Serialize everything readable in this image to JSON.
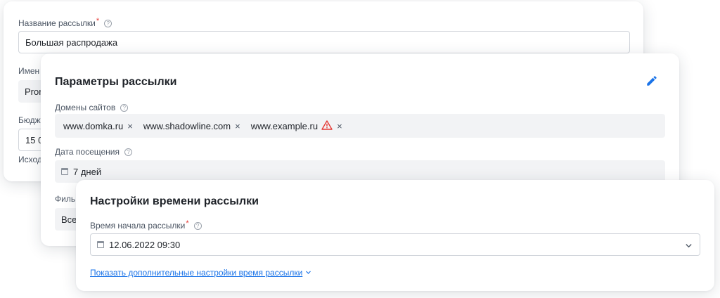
{
  "campaign_card": {
    "name_label": "Название рассылки",
    "name_required": "*",
    "name_value": "Большая распродажа",
    "sender_label_partial": "Имен",
    "sender_value_partial": "Pron",
    "budget_label_partial": "Бюдж",
    "budget_value_partial": "15 0",
    "source_label_partial": "Исход"
  },
  "params_card": {
    "title": "Параметры рассылки",
    "domains_label": "Домены сайтов",
    "domains": [
      {
        "text": "www.domka.ru",
        "warning": false
      },
      {
        "text": "www.shadowline.com",
        "warning": false
      },
      {
        "text": "www.example.ru",
        "warning": true
      }
    ],
    "tag_remove": "×",
    "visit_date_label": "Дата посещения",
    "visit_date_value": "7 дней",
    "filter_label_partial": "Филь",
    "filter_value_partial": "Все"
  },
  "time_card": {
    "title": "Настройки времени рассылки",
    "start_time_label": "Время начала рассылки",
    "start_time_required": "*",
    "start_time_value": "12.06.2022 09:30",
    "more_settings_link": "Показать дополнительные настройки время рассылки"
  },
  "colors": {
    "accent": "#1a73e8",
    "required": "#e53935",
    "warning": "#e53935",
    "field_fill": "#f2f3f5"
  }
}
